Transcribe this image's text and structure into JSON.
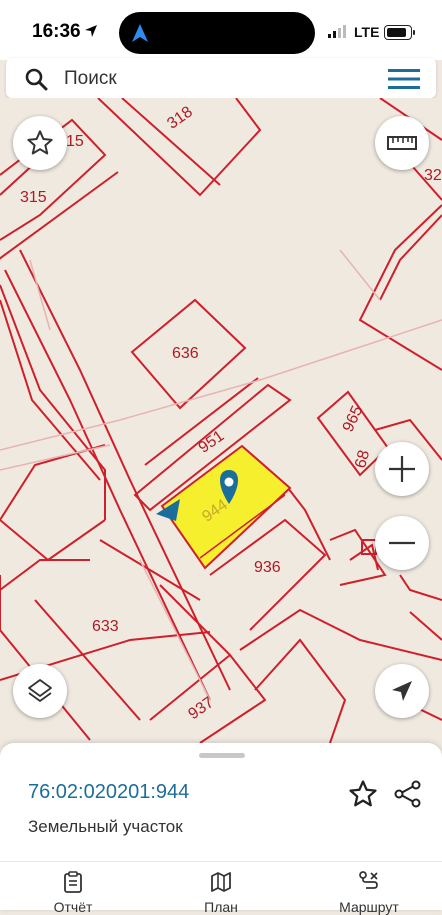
{
  "status_bar": {
    "time": "16:36",
    "network": "LTE"
  },
  "search": {
    "placeholder": "Поиск"
  },
  "map": {
    "parcel_labels": {
      "p315": "315",
      "p315b": "15",
      "p318": "318",
      "p32": "32",
      "p636": "636",
      "p951": "951",
      "p965": "965",
      "p68": "68",
      "p944": "944",
      "p936": "936",
      "p633": "633",
      "p937": "937"
    },
    "highlight_color": "#f5ef2e",
    "boundary_color": "#cf1f2b"
  },
  "parcel": {
    "cadastral_number": "76:02:020201:944",
    "type": "Земельный участок"
  },
  "tabs": [
    {
      "label": "Отчёт"
    },
    {
      "label": "План"
    },
    {
      "label": "Маршрут"
    }
  ]
}
